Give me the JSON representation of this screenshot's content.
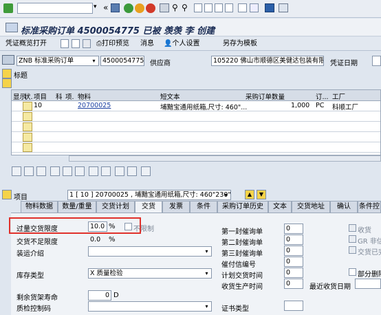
{
  "toolbar": {
    "command_field": "",
    "icons": [
      "enter-icon",
      "save-icon",
      "back-icon",
      "exit-icon",
      "cancel-icon",
      "print-icon",
      "find-icon",
      "find-next-icon",
      "first-page-icon",
      "prev-page-icon",
      "next-page-icon",
      "last-page-icon",
      "new-session-icon",
      "shortcut-icon",
      "help-icon",
      "customize-icon"
    ]
  },
  "title": "标准采购订单 4500054775 已被 羡羡 李 创建",
  "app_toolbar": {
    "overview": "凭证概览打开",
    "print_preview": "打印预览",
    "messages": "消息",
    "personal_settings": "个人设置",
    "save_as_template": "另存为模板"
  },
  "header": {
    "order_type": "ZNB 标准采购订单",
    "po_number": "4500054775",
    "vendor_label": "供应商",
    "vendor_value": "105220 佛山市顺德区美健达包装有限...",
    "doc_date_label": "凭证日期",
    "header_label": "标题"
  },
  "grid": {
    "columns": [
      "显示",
      "状.",
      "项目",
      "科",
      "项.",
      "物料",
      "短文本",
      "采购订单数量",
      "订...",
      "工厂"
    ],
    "rows": [
      {
        "item": "10",
        "material": "20700025",
        "short_text": "埔黯宝通用纸箱,尺寸: 460\"...",
        "qty": "1,000",
        "unit": "PC",
        "plant": "科顺工厂"
      }
    ]
  },
  "item_selector": {
    "label": "项目",
    "value": "1 [ 10 ] 20700025 , 埔黯宝通用纸箱,尺寸: 460\"230\"..."
  },
  "tabs": [
    "物料数据",
    "数量/重量",
    "交货计划",
    "交货",
    "发票",
    "条件",
    "采购订单历史",
    "文本",
    "交货地址",
    "确认",
    "条件控"
  ],
  "active_tab": "交货",
  "delivery": {
    "over_tol_label": "过量交货限度",
    "over_tol_value": "10.0",
    "pct": "%",
    "unlimited_label": "不限制",
    "under_tol_label": "交货不足限度",
    "under_tol_value": "0.0",
    "shipping_instr_label": "装运介绍",
    "stock_type_label": "库存类型",
    "stock_type_value": "X 质量检验",
    "rem_shelf_label": "剩余货架寿命",
    "rem_shelf_value": "0",
    "rem_shelf_unit": "D",
    "qm_ctrl_label": "质检控制码",
    "reminder1_label": "第一封催询单",
    "reminder1_value": "0",
    "reminder2_label": "第二封催询单",
    "reminder2_value": "0",
    "reminder3_label": "第三封催询单",
    "reminder3_value": "0",
    "no_exped_label": "催付信编号",
    "no_exped_value": "0",
    "plan_del_label": "计划交货时间",
    "plan_del_value": "0",
    "gr_proc_label": "收货生产时间",
    "gr_proc_value": "0",
    "latest_gr_label": "最近收货日期",
    "cert_label": "证书类型",
    "gr_label": "收货",
    "gr_nonval_label": "GR 非估价",
    "del_completed_label": "交货已完",
    "partial_del_label": "部分删除"
  },
  "colors": {
    "highlight_box": "#e0302a",
    "title": "#1b2d55"
  }
}
